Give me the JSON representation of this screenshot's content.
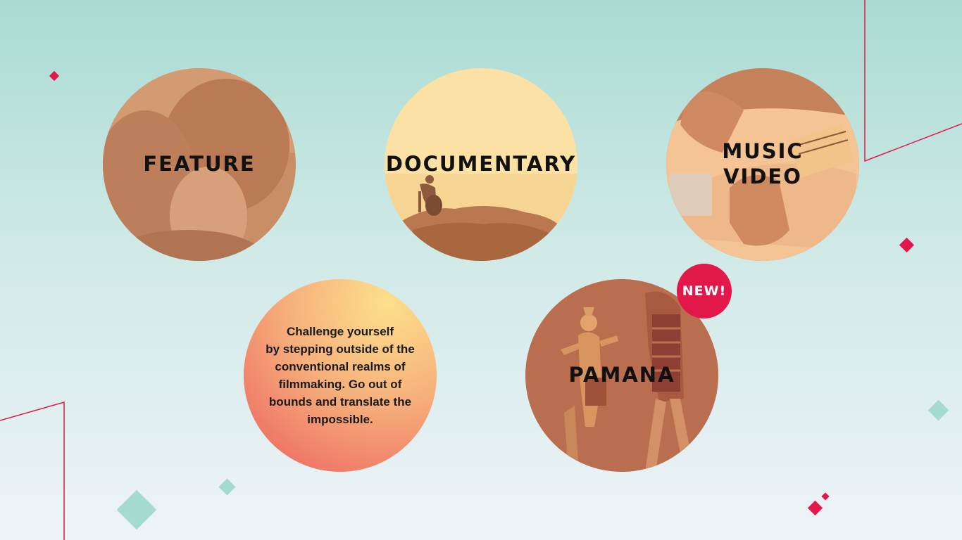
{
  "categories": {
    "feature": {
      "label": "FEATURE"
    },
    "documentary": {
      "label": "DOCUMENTARY"
    },
    "music_video": {
      "label_line1": "MUSIC",
      "label_line2": "VIDEO"
    },
    "pamana": {
      "label": "PAMANA",
      "badge": "NEW!"
    }
  },
  "challenge": {
    "lines": [
      "Challenge yourself",
      "by stepping outside of the",
      "conventional realms of",
      "filmmaking. Go out of",
      "bounds and translate the",
      "impossible."
    ]
  },
  "colors": {
    "accent": "#e3184a",
    "teal_diamond": "#a5dbcf"
  }
}
